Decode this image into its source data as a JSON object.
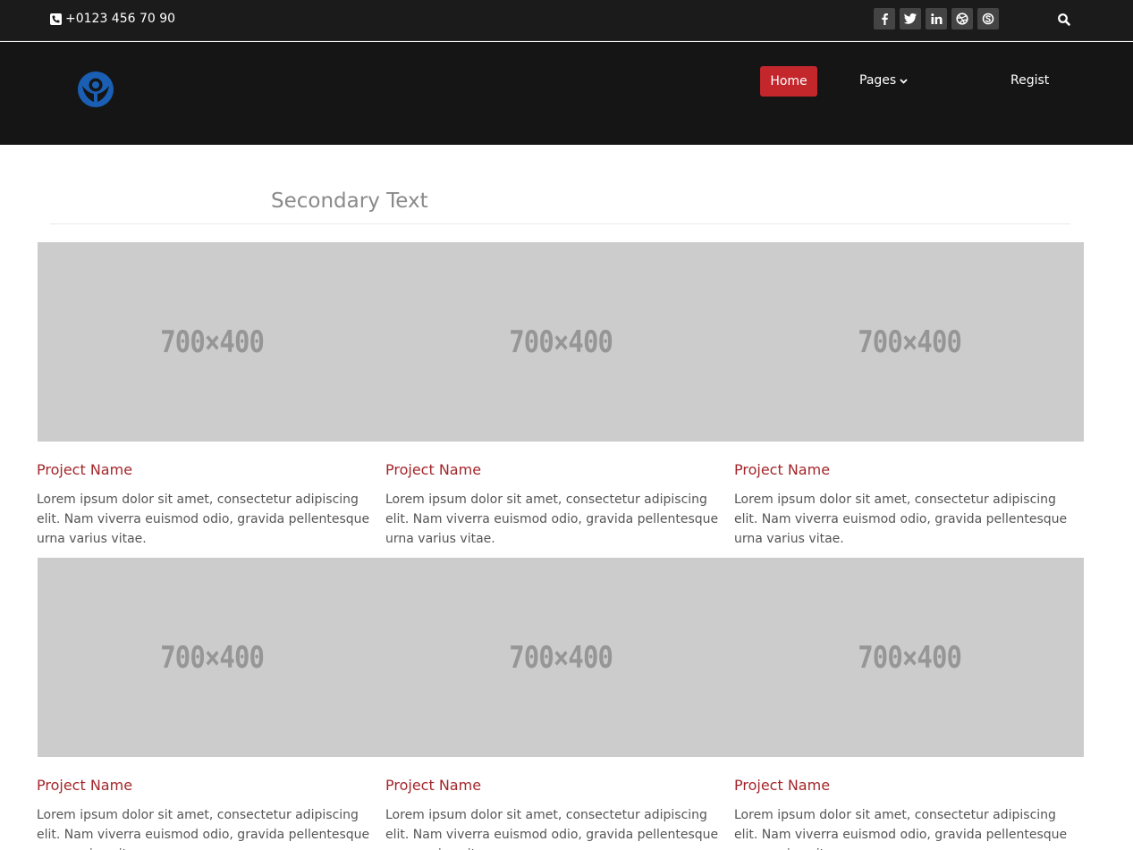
{
  "topbar": {
    "phone": "+0123 456 70 90",
    "socials": [
      {
        "icon": "facebook-icon",
        "glyph": "f"
      },
      {
        "icon": "twitter-icon",
        "glyph": "t"
      },
      {
        "icon": "linkedin-icon",
        "glyph": "in"
      },
      {
        "icon": "dribbble-icon",
        "glyph": "d"
      },
      {
        "icon": "skype-icon",
        "glyph": "s"
      }
    ]
  },
  "nav": {
    "home": "Home",
    "pages": "Pages",
    "regist": "Regist"
  },
  "section": {
    "title": "Secondary Text"
  },
  "projects": [
    {
      "image": "700×400",
      "name": "Project Name",
      "desc": "Lorem ipsum dolor sit amet, consectetur adipiscing elit. Nam viverra euismod odio, gravida pellentesque urna varius vitae."
    },
    {
      "image": "700×400",
      "name": "Project Name",
      "desc": "Lorem ipsum dolor sit amet, consectetur adipiscing elit. Nam viverra euismod odio, gravida pellentesque urna varius vitae."
    },
    {
      "image": "700×400",
      "name": "Project Name",
      "desc": "Lorem ipsum dolor sit amet, consectetur adipiscing elit. Nam viverra euismod odio, gravida pellentesque urna varius vitae."
    },
    {
      "image": "700×400",
      "name": "Project Name",
      "desc": "Lorem ipsum dolor sit amet, consectetur adipiscing elit. Nam viverra euismod odio, gravida pellentesque urna varius vitae."
    },
    {
      "image": "700×400",
      "name": "Project Name",
      "desc": "Lorem ipsum dolor sit amet, consectetur adipiscing elit. Nam viverra euismod odio, gravida pellentesque urna varius vitae."
    },
    {
      "image": "700×400",
      "name": "Project Name",
      "desc": "Lorem ipsum dolor sit amet, consectetur adipiscing elit. Nam viverra euismod odio, gravida pellentesque urna varius vitae."
    }
  ],
  "colors": {
    "accent": "#c3272b",
    "project_name": "#a3262a",
    "topbar_bg": "#1b1b1b",
    "navbar_bg": "#151515",
    "placeholder_bg": "#cccccc",
    "logo": "#1a5fb4"
  }
}
